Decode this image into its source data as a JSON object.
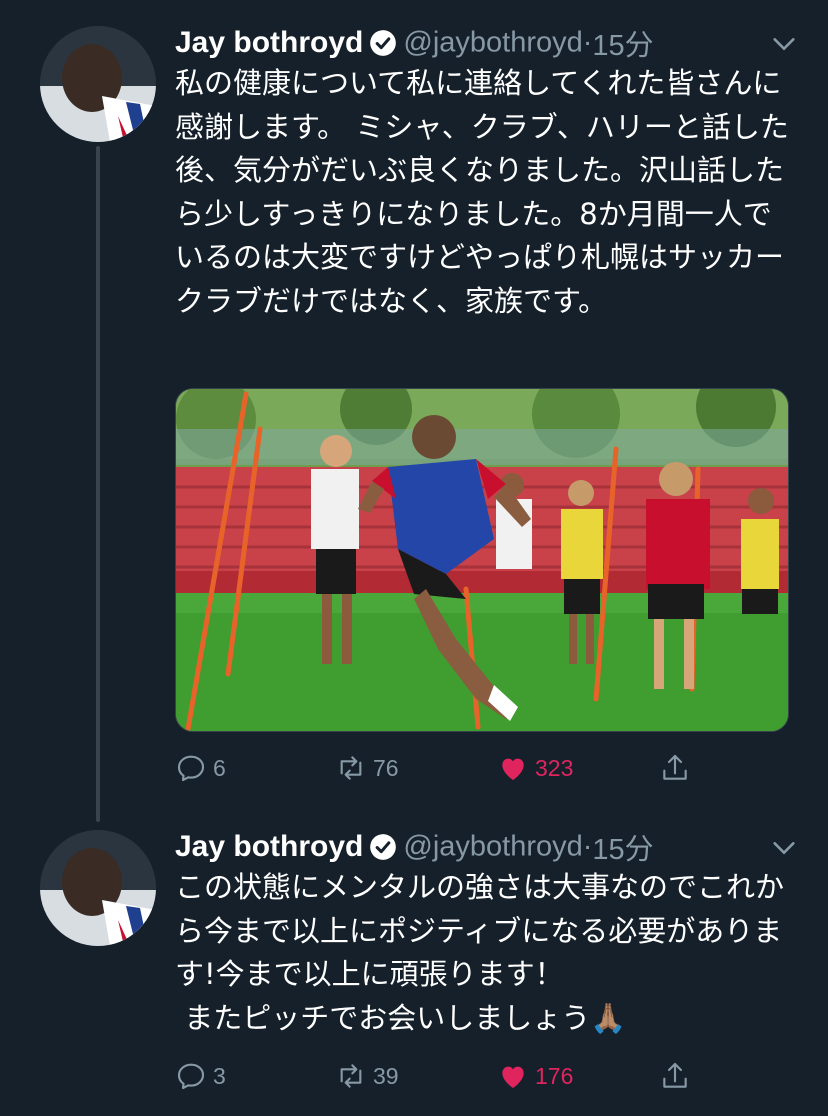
{
  "tweets": [
    {
      "author_name": "Jay bothroyd",
      "handle": "@jaybothroyd",
      "separator": "·",
      "time": "15分",
      "text": "私の健康について私に連絡してくれた皆さんに感謝します。 ミシャ、クラブ、ハリーと話した後、気分がだいぶ良くなりました。沢山話したら少しすっきりになりました。8か月間一人でいるのは大変ですけどやっぱり札幌はサッカークラブだけではなく、家族です。",
      "has_media": true,
      "actions": {
        "replies": "6",
        "retweets": "76",
        "likes": "323",
        "liked": true
      }
    },
    {
      "author_name": "Jay bothroyd",
      "handle": "@jaybothroyd",
      "separator": "·",
      "time": "15分",
      "text": "この状態にメンタルの強さは大事なのでこれから今まで以上にポジティブになる必要があります!今まで以上に頑張ります！\n またピッチでお会いしましょう🙏🏽",
      "has_media": false,
      "actions": {
        "replies": "3",
        "retweets": "39",
        "likes": "176",
        "liked": true
      }
    }
  ],
  "icons": {
    "verified": "verified-badge-icon",
    "caret": "chevron-down-icon",
    "reply": "reply-icon",
    "retweet": "retweet-icon",
    "like": "heart-icon",
    "share": "share-icon"
  },
  "colors": {
    "background": "#15202b",
    "text": "#ffffff",
    "secondary_text": "#8899a6",
    "like": "#e0245e",
    "divider": "#38444d",
    "pitch_green": "#3f9e2f",
    "jersey_red": "#c8102e",
    "bib_blue": "#2446a8",
    "bib_yellow": "#e9d63a",
    "pole_orange": "#e8632a"
  }
}
